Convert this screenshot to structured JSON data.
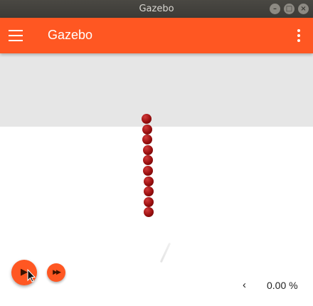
{
  "window": {
    "title": "Gazebo",
    "buttons": [
      "minimize-icon",
      "maximize-icon",
      "close-icon"
    ]
  },
  "appbar": {
    "title": "Gazebo",
    "menu_icon": "hamburger-menu-icon",
    "overflow_icon": "more-vertical-icon",
    "color": "#ff5722"
  },
  "scene": {
    "sky_color": "#e6e6e6",
    "ground_color": "#ffffff",
    "ball_color": "#9a0f0f",
    "ball_count": 10
  },
  "controls": {
    "play_icon": "play-icon",
    "fast_forward_icon": "fast-forward-icon",
    "rtf_chevron": "‹",
    "rtf_value": "0.00 %"
  }
}
